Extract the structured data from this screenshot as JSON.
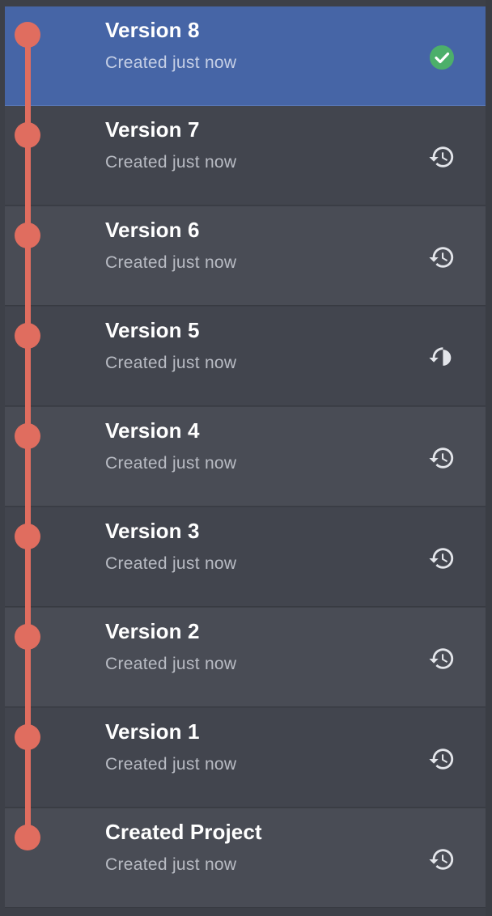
{
  "versions": [
    {
      "title": "Version 8",
      "subtitle": "Created just now",
      "status_icon": "check-circle-icon",
      "active": true
    },
    {
      "title": "Version 7",
      "subtitle": "Created just now",
      "status_icon": "history-icon",
      "active": false
    },
    {
      "title": "Version 6",
      "subtitle": "Created just now",
      "status_icon": "history-icon",
      "active": false
    },
    {
      "title": "Version 5",
      "subtitle": "Created just now",
      "status_icon": "history-icon",
      "active": false
    },
    {
      "title": "Version 4",
      "subtitle": "Created just now",
      "status_icon": "history-icon",
      "active": false
    },
    {
      "title": "Version 3",
      "subtitle": "Created just now",
      "status_icon": "history-icon",
      "active": false
    },
    {
      "title": "Version 2",
      "subtitle": "Created just now",
      "status_icon": "history-icon",
      "active": false
    },
    {
      "title": "Version 1",
      "subtitle": "Created just now",
      "status_icon": "history-icon",
      "active": false
    },
    {
      "title": "Created Project",
      "subtitle": "Created just now",
      "status_icon": "history-icon",
      "active": false
    }
  ],
  "colors": {
    "panel_bg": "#3d4048",
    "row_dark": "#42454e",
    "row_light": "#494c55",
    "active_row": "#4665a6",
    "timeline": "#e06d5f",
    "check_green": "#4caf6a",
    "history_icon": "#e3e5ea"
  }
}
